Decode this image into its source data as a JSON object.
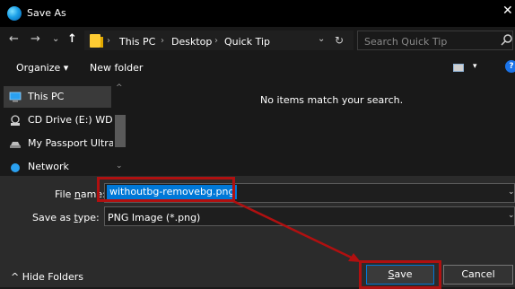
{
  "window": {
    "title": "Save As",
    "close_glyph": "✕"
  },
  "nav": {
    "back_glyph": "←",
    "forward_glyph": "→",
    "recent_glyph": "⌄",
    "up_glyph": "↑",
    "breadcrumb": [
      "This PC",
      "Desktop",
      "Quick Tip"
    ],
    "separator": "›",
    "dropdown_glyph": "⌄",
    "refresh_glyph": "↻",
    "search_placeholder": "Search Quick Tip"
  },
  "toolbar": {
    "organize_label": "Organize ▾",
    "new_folder_label": "New folder",
    "view_caret": "▾",
    "help_label": "?"
  },
  "sidebar": {
    "items": [
      {
        "label": "This PC",
        "icon": "monitor-icon",
        "selected": true
      },
      {
        "label": "CD Drive (E:) WD U",
        "icon": "cd-drive-icon",
        "selected": false
      },
      {
        "label": "My Passport Ultra",
        "icon": "external-drive-icon",
        "selected": false
      },
      {
        "label": "Network",
        "icon": "network-icon",
        "selected": false
      }
    ],
    "scroll_up": "^",
    "scroll_down": "⌄"
  },
  "content": {
    "empty_message": "No items match your search."
  },
  "form": {
    "file_name_label_pre": "File ",
    "file_name_label_key": "n",
    "file_name_label_post": "ame:",
    "file_name_value": "withoutbg-removebg.png",
    "save_type_label_pre": "Save as ",
    "save_type_label_key": "t",
    "save_type_label_post": "ype:",
    "save_type_value": "PNG Image (*.png)",
    "caret": "⌄"
  },
  "footer": {
    "hide_folders_label": "^  Hide Folders",
    "save_key": "S",
    "save_rest": "ave",
    "cancel_label": "Cancel"
  },
  "colors": {
    "accent": "#0078d7",
    "annotation": "#b01010"
  }
}
